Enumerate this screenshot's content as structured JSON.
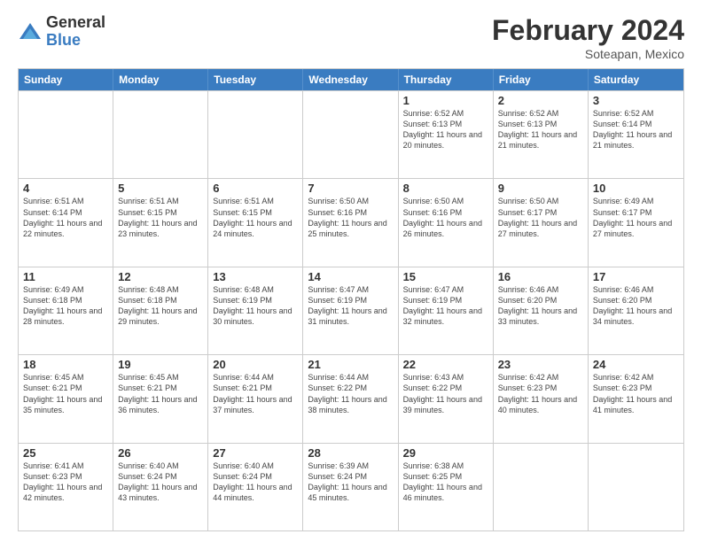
{
  "logo": {
    "general": "General",
    "blue": "Blue"
  },
  "header": {
    "title": "February 2024",
    "location": "Soteapan, Mexico"
  },
  "days_of_week": [
    "Sunday",
    "Monday",
    "Tuesday",
    "Wednesday",
    "Thursday",
    "Friday",
    "Saturday"
  ],
  "weeks": [
    [
      {
        "day": "",
        "info": ""
      },
      {
        "day": "",
        "info": ""
      },
      {
        "day": "",
        "info": ""
      },
      {
        "day": "",
        "info": ""
      },
      {
        "day": "1",
        "info": "Sunrise: 6:52 AM\nSunset: 6:13 PM\nDaylight: 11 hours and 20 minutes."
      },
      {
        "day": "2",
        "info": "Sunrise: 6:52 AM\nSunset: 6:13 PM\nDaylight: 11 hours and 21 minutes."
      },
      {
        "day": "3",
        "info": "Sunrise: 6:52 AM\nSunset: 6:14 PM\nDaylight: 11 hours and 21 minutes."
      }
    ],
    [
      {
        "day": "4",
        "info": "Sunrise: 6:51 AM\nSunset: 6:14 PM\nDaylight: 11 hours and 22 minutes."
      },
      {
        "day": "5",
        "info": "Sunrise: 6:51 AM\nSunset: 6:15 PM\nDaylight: 11 hours and 23 minutes."
      },
      {
        "day": "6",
        "info": "Sunrise: 6:51 AM\nSunset: 6:15 PM\nDaylight: 11 hours and 24 minutes."
      },
      {
        "day": "7",
        "info": "Sunrise: 6:50 AM\nSunset: 6:16 PM\nDaylight: 11 hours and 25 minutes."
      },
      {
        "day": "8",
        "info": "Sunrise: 6:50 AM\nSunset: 6:16 PM\nDaylight: 11 hours and 26 minutes."
      },
      {
        "day": "9",
        "info": "Sunrise: 6:50 AM\nSunset: 6:17 PM\nDaylight: 11 hours and 27 minutes."
      },
      {
        "day": "10",
        "info": "Sunrise: 6:49 AM\nSunset: 6:17 PM\nDaylight: 11 hours and 27 minutes."
      }
    ],
    [
      {
        "day": "11",
        "info": "Sunrise: 6:49 AM\nSunset: 6:18 PM\nDaylight: 11 hours and 28 minutes."
      },
      {
        "day": "12",
        "info": "Sunrise: 6:48 AM\nSunset: 6:18 PM\nDaylight: 11 hours and 29 minutes."
      },
      {
        "day": "13",
        "info": "Sunrise: 6:48 AM\nSunset: 6:19 PM\nDaylight: 11 hours and 30 minutes."
      },
      {
        "day": "14",
        "info": "Sunrise: 6:47 AM\nSunset: 6:19 PM\nDaylight: 11 hours and 31 minutes."
      },
      {
        "day": "15",
        "info": "Sunrise: 6:47 AM\nSunset: 6:19 PM\nDaylight: 11 hours and 32 minutes."
      },
      {
        "day": "16",
        "info": "Sunrise: 6:46 AM\nSunset: 6:20 PM\nDaylight: 11 hours and 33 minutes."
      },
      {
        "day": "17",
        "info": "Sunrise: 6:46 AM\nSunset: 6:20 PM\nDaylight: 11 hours and 34 minutes."
      }
    ],
    [
      {
        "day": "18",
        "info": "Sunrise: 6:45 AM\nSunset: 6:21 PM\nDaylight: 11 hours and 35 minutes."
      },
      {
        "day": "19",
        "info": "Sunrise: 6:45 AM\nSunset: 6:21 PM\nDaylight: 11 hours and 36 minutes."
      },
      {
        "day": "20",
        "info": "Sunrise: 6:44 AM\nSunset: 6:21 PM\nDaylight: 11 hours and 37 minutes."
      },
      {
        "day": "21",
        "info": "Sunrise: 6:44 AM\nSunset: 6:22 PM\nDaylight: 11 hours and 38 minutes."
      },
      {
        "day": "22",
        "info": "Sunrise: 6:43 AM\nSunset: 6:22 PM\nDaylight: 11 hours and 39 minutes."
      },
      {
        "day": "23",
        "info": "Sunrise: 6:42 AM\nSunset: 6:23 PM\nDaylight: 11 hours and 40 minutes."
      },
      {
        "day": "24",
        "info": "Sunrise: 6:42 AM\nSunset: 6:23 PM\nDaylight: 11 hours and 41 minutes."
      }
    ],
    [
      {
        "day": "25",
        "info": "Sunrise: 6:41 AM\nSunset: 6:23 PM\nDaylight: 11 hours and 42 minutes."
      },
      {
        "day": "26",
        "info": "Sunrise: 6:40 AM\nSunset: 6:24 PM\nDaylight: 11 hours and 43 minutes."
      },
      {
        "day": "27",
        "info": "Sunrise: 6:40 AM\nSunset: 6:24 PM\nDaylight: 11 hours and 44 minutes."
      },
      {
        "day": "28",
        "info": "Sunrise: 6:39 AM\nSunset: 6:24 PM\nDaylight: 11 hours and 45 minutes."
      },
      {
        "day": "29",
        "info": "Sunrise: 6:38 AM\nSunset: 6:25 PM\nDaylight: 11 hours and 46 minutes."
      },
      {
        "day": "",
        "info": ""
      },
      {
        "day": "",
        "info": ""
      }
    ]
  ]
}
